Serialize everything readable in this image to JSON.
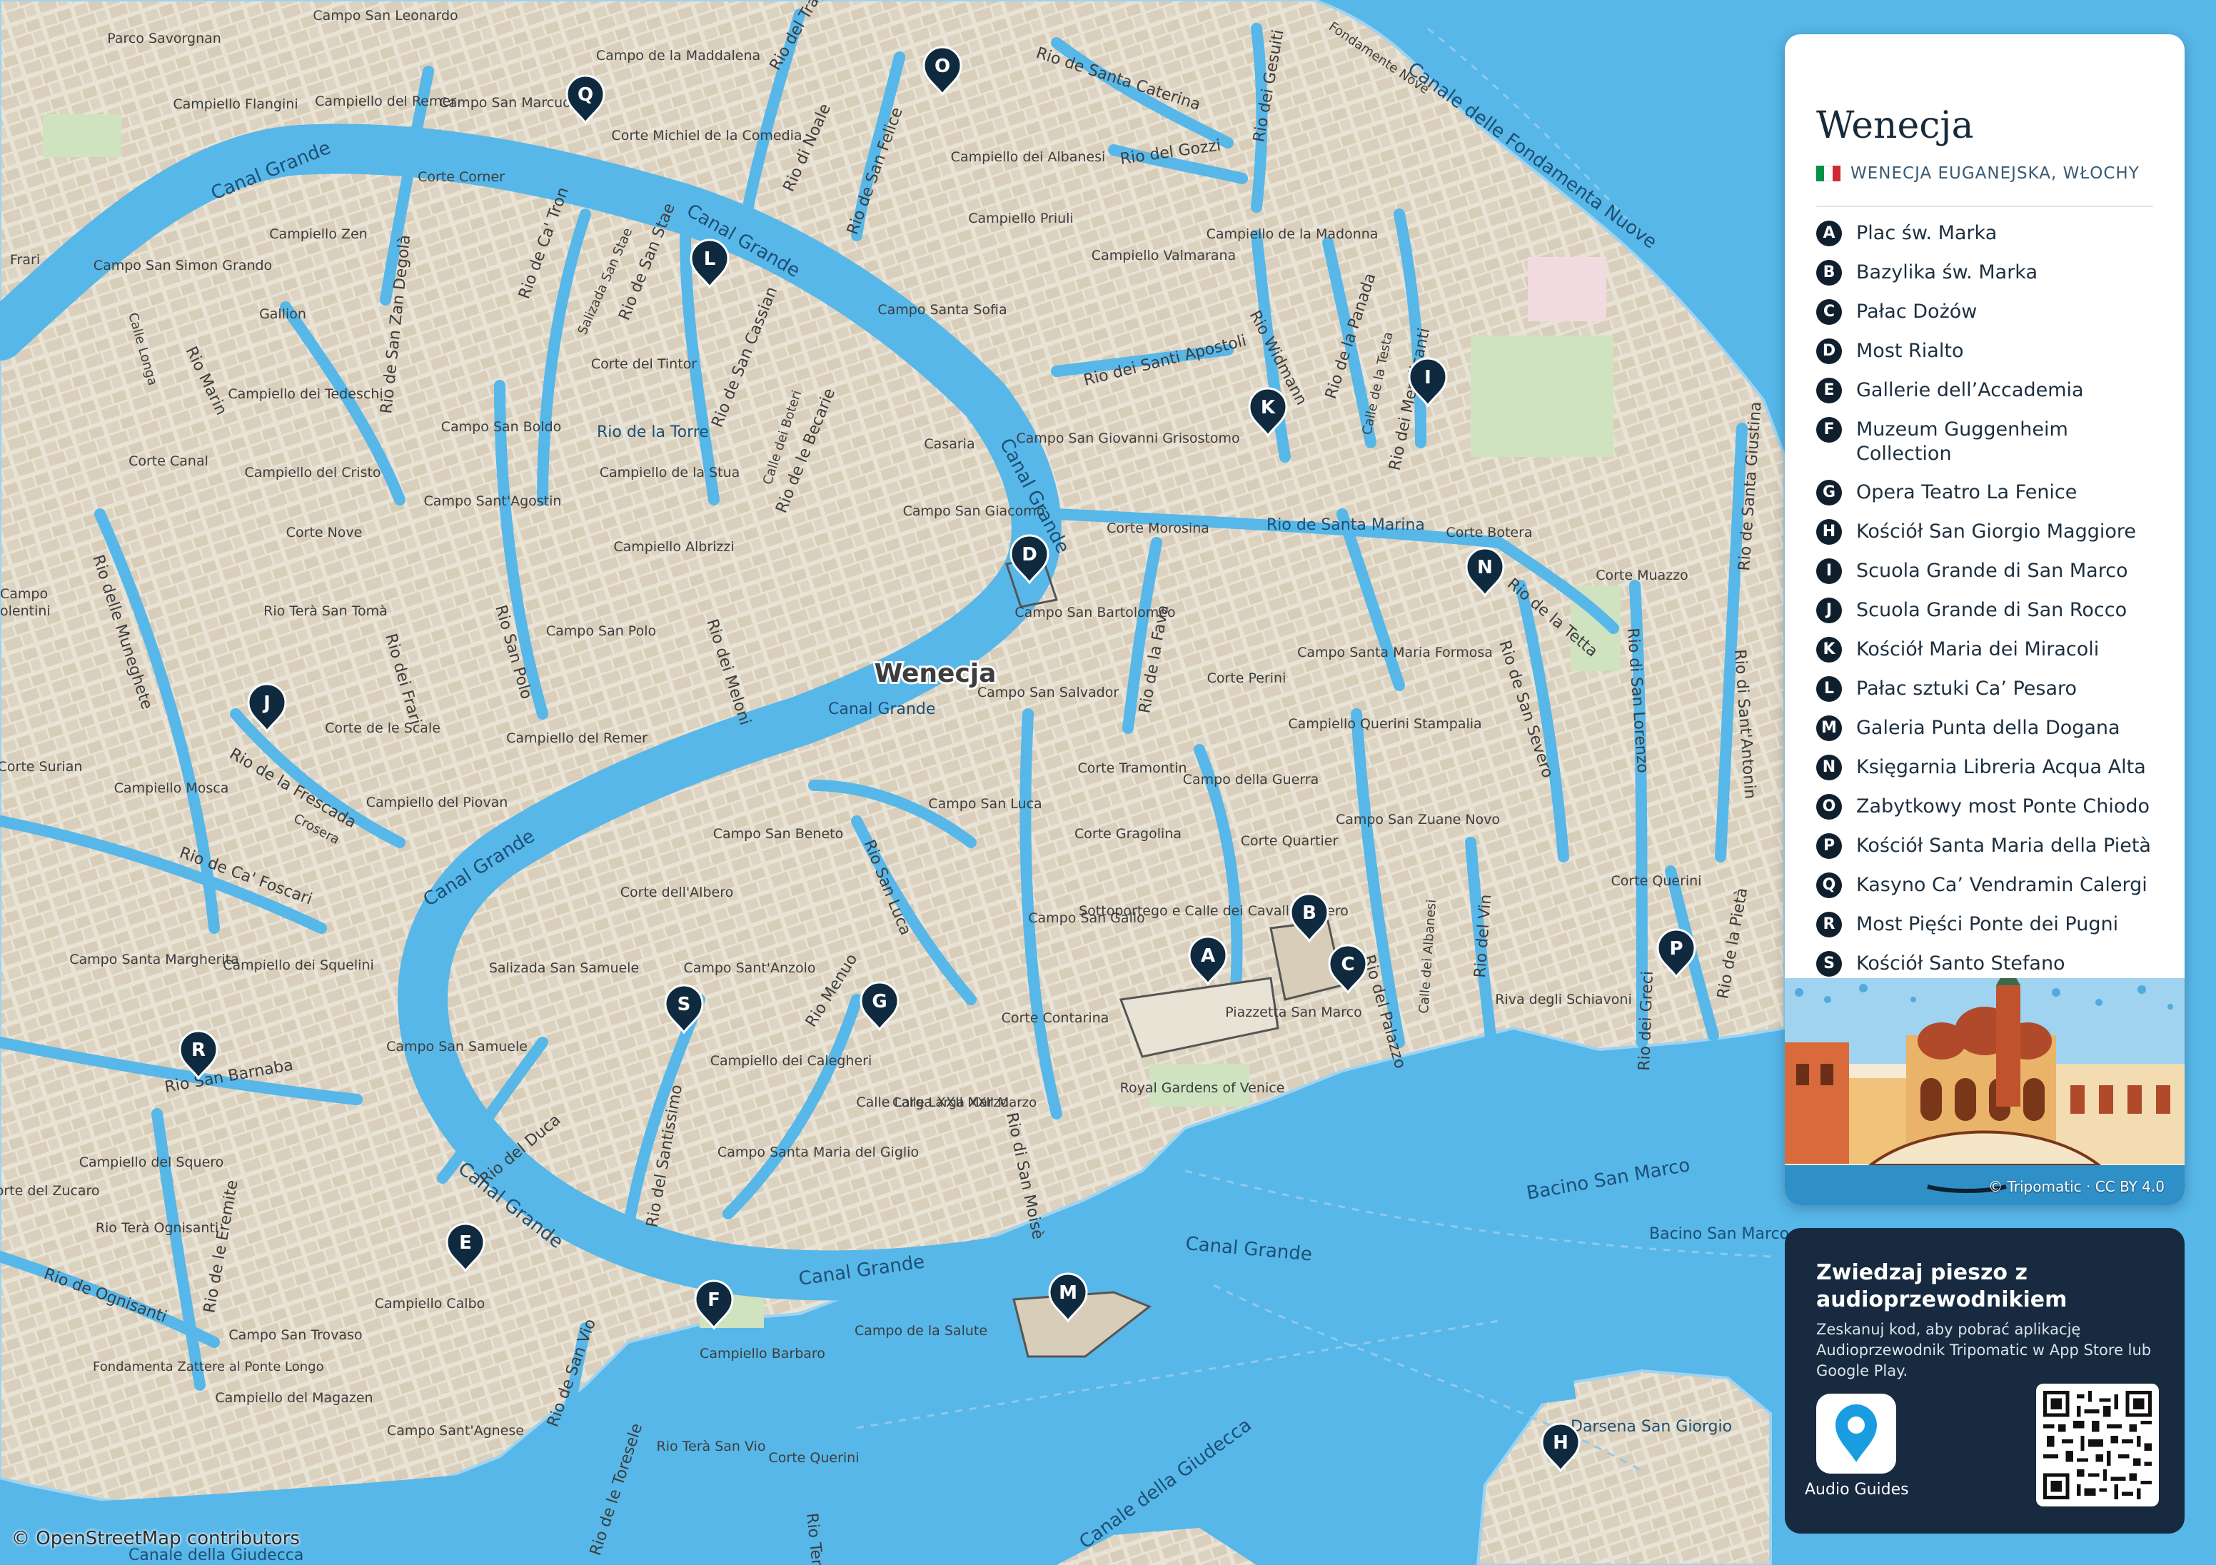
{
  "map": {
    "city_label": "Wenecja",
    "water_labels": [
      {
        "id": "canal-grande-1",
        "text": "Canal Grande"
      },
      {
        "id": "canal-grande-2",
        "text": "Canal Grande"
      },
      {
        "id": "canal-grande-3",
        "text": "Canal Grande"
      },
      {
        "id": "canal-grande-4",
        "text": "Canal Grande"
      },
      {
        "id": "canal-grande-5",
        "text": "Canal Grande"
      },
      {
        "id": "canal-grande-6",
        "text": "Canal Grande"
      },
      {
        "id": "canal-grande-7",
        "text": "Canal Grande"
      },
      {
        "id": "canal-grande-8",
        "text": "Canal Grande"
      },
      {
        "id": "bacino",
        "text": "Bacino San Marco"
      },
      {
        "id": "bacino-2",
        "text": "Bacino San Marco"
      },
      {
        "id": "darsena",
        "text": "Darsena San Giorgio"
      },
      {
        "id": "fondamenta-nuove",
        "text": "Canale delle Fondamenta Nuove"
      },
      {
        "id": "giudecca",
        "text": "Canale della Giudecca"
      },
      {
        "id": "giudecca-2",
        "text": "Canale della Giudecca"
      },
      {
        "id": "rio-torre",
        "text": "Rio de la Torre"
      },
      {
        "id": "rio-santa-marina",
        "text": "Rio de Santa Marina"
      }
    ],
    "street_labels": [
      {
        "id": "rio-trapolin",
        "text": "Rio del Trapolin"
      },
      {
        "id": "rio-santa-caterina",
        "text": "Rio de Santa Caterina"
      },
      {
        "id": "rio-noale",
        "text": "Rio di Noale"
      },
      {
        "id": "rio-san-felice",
        "text": "Rio de San Felice"
      },
      {
        "id": "rio-gozzi",
        "text": "Rio del Gozzi"
      },
      {
        "id": "rio-gesuiti",
        "text": "Rio dei Gesuiti"
      },
      {
        "id": "rio-ca-tron",
        "text": "Rio de Ca' Tron"
      },
      {
        "id": "rio-san-stae",
        "text": "Rio de San Stae"
      },
      {
        "id": "salizada-san-stae",
        "text": "Salizada San Stae"
      },
      {
        "id": "rio-san-cassian",
        "text": "Rio de San Cassian"
      },
      {
        "id": "rio-zan-degola",
        "text": "Rio de San Zan Degolà"
      },
      {
        "id": "rio-marin",
        "text": "Rio Marin"
      },
      {
        "id": "calle-longa",
        "text": "Calle Longa"
      },
      {
        "id": "calle-boteri",
        "text": "Calle dei Boteri"
      },
      {
        "id": "rio-becarie",
        "text": "Rio de le Becarie"
      },
      {
        "id": "rio-santi-apostoli",
        "text": "Rio dei Santi Apostoli"
      },
      {
        "id": "rio-widmann",
        "text": "Rio Widmann"
      },
      {
        "id": "rio-panada",
        "text": "Rio de la Panada"
      },
      {
        "id": "calle-testa",
        "text": "Calle de la Testa"
      },
      {
        "id": "rio-mendicanti",
        "text": "Rio dei Mendicanti"
      },
      {
        "id": "rio-santa-giustina",
        "text": "Rio de Santa Giustina"
      },
      {
        "id": "rio-muneghete",
        "text": "Rio delle Muneghete"
      },
      {
        "id": "rio-frari",
        "text": "Rio dei Frari"
      },
      {
        "id": "rio-san-polo",
        "text": "Rio San Polo"
      },
      {
        "id": "rio-meloni",
        "text": "Rio dei Meloni"
      },
      {
        "id": "rio-fava",
        "text": "Rio de la Fava"
      },
      {
        "id": "rio-tetta",
        "text": "Rio de la Tetta"
      },
      {
        "id": "rio-san-severo",
        "text": "Rio de San Severo"
      },
      {
        "id": "rio-san-lorenzo",
        "text": "Rio di San Lorenzo"
      },
      {
        "id": "rio-san-antonin",
        "text": "Rio di Sant'Antonin"
      },
      {
        "id": "rio-frescada",
        "text": "Rio de la Frescada"
      },
      {
        "id": "crosera",
        "text": "Crosera"
      },
      {
        "id": "rio-ca-foscari",
        "text": "Rio de Ca' Foscari"
      },
      {
        "id": "rio-san-luca",
        "text": "Rio San Luca"
      },
      {
        "id": "rio-menuo",
        "text": "Rio Menuo"
      },
      {
        "id": "rio-palazzo",
        "text": "Rio del Palazzo"
      },
      {
        "id": "calle-albanesi",
        "text": "Calle dei Albanesi"
      },
      {
        "id": "rio-vin",
        "text": "Rio del Vin"
      },
      {
        "id": "rio-greci",
        "text": "Rio dei Greci"
      },
      {
        "id": "rio-pieta",
        "text": "Rio de la Pietà"
      },
      {
        "id": "rio-san-barnaba",
        "text": "Rio San Barnaba"
      },
      {
        "id": "rio-duca",
        "text": "Rio del Duca"
      },
      {
        "id": "rio-santissimo",
        "text": "Rio del Santissimo"
      },
      {
        "id": "rio-san-moise",
        "text": "Rio di San Moisè"
      },
      {
        "id": "rio-eremite",
        "text": "Rio de le Eremite"
      },
      {
        "id": "rio-ognisanti",
        "text": "Rio de Ognisanti"
      },
      {
        "id": "rio-san-vio",
        "text": "Rio de San Vio"
      },
      {
        "id": "rio-toresele",
        "text": "Rio de le Toresele"
      },
      {
        "id": "rio-terra-san-vio",
        "text": "Rio Terà"
      },
      {
        "id": "fondamenta-nuove-st",
        "text": "Fondamente Nove"
      },
      {
        "id": "calle-larga-xxii",
        "text": "Calle Larga XXII Marzo"
      },
      {
        "id": "fondamenta-zattere",
        "text": "Fondamenta Zattere al Ponte Longo"
      }
    ],
    "place_labels": [
      {
        "id": "parco-savorgnan",
        "text": "Parco Savorgnan"
      },
      {
        "id": "campo-san-leonardo",
        "text": "Campo San Leonardo"
      },
      {
        "id": "campiello-flangini",
        "text": "Campiello Flangini"
      },
      {
        "id": "campiello-remer",
        "text": "Campiello del Remer"
      },
      {
        "id": "campo-maddalena",
        "text": "Campo de la Maddalena"
      },
      {
        "id": "campo-san-marcuola",
        "text": "Campo San Marcuola"
      },
      {
        "id": "corte-michiel",
        "text": "Corte Michiel de la Comedia"
      },
      {
        "id": "campiello-albanesi",
        "text": "Campiello dei Albanesi"
      },
      {
        "id": "corte-corner",
        "text": "Corte Corner"
      },
      {
        "id": "campiello-zen",
        "text": "Campiello Zen"
      },
      {
        "id": "campo-san-simon",
        "text": "Campo San Simon Grando"
      },
      {
        "id": "gallion",
        "text": "Gallion"
      },
      {
        "id": "campiello-priuli",
        "text": "Campiello Priuli"
      },
      {
        "id": "campiello-madonna",
        "text": "Campiello de la Madonna"
      },
      {
        "id": "campiello-valmarana",
        "text": "Campiello Valmarana"
      },
      {
        "id": "campo-santa-sofia",
        "text": "Campo Santa Sofia"
      },
      {
        "id": "corte-tintor",
        "text": "Corte del Tintor"
      },
      {
        "id": "campiello-tedeschi",
        "text": "Campiello dei Tedeschi"
      },
      {
        "id": "campo-san-boldo",
        "text": "Campo San Boldo"
      },
      {
        "id": "corte-canal",
        "text": "Corte Canal"
      },
      {
        "id": "campiello-cristo",
        "text": "Campiello del Cristo"
      },
      {
        "id": "campiello-stua",
        "text": "Campiello de la Stua"
      },
      {
        "id": "casaria",
        "text": "Casaria"
      },
      {
        "id": "campo-san-giovanni",
        "text": "Campo San Giovanni Grisostomo"
      },
      {
        "id": "campo-santagostin",
        "text": "Campo Sant'Agostin"
      },
      {
        "id": "corte-nove",
        "text": "Corte Nove"
      },
      {
        "id": "campiello-albrizzi",
        "text": "Campiello Albrizzi"
      },
      {
        "id": "campo-san-giacomo",
        "text": "Campo San Giacomo"
      },
      {
        "id": "corte-morosina",
        "text": "Corte Morosina"
      },
      {
        "id": "corte-botera",
        "text": "Corte Botera"
      },
      {
        "id": "corte-muazzo",
        "text": "Corte Muazzo"
      },
      {
        "id": "rio-terra-san-toma",
        "text": "Rio Terà San Tomà"
      },
      {
        "id": "campo-san-polo",
        "text": "Campo San Polo"
      },
      {
        "id": "campo-san-bartolomeo",
        "text": "Campo San Bartolomeo"
      },
      {
        "id": "campo-santa-maria-formosa",
        "text": "Campo Santa Maria Formosa"
      },
      {
        "id": "corte-perini",
        "text": "Corte Perini"
      },
      {
        "id": "corte-scale",
        "text": "Corte de le Scale"
      },
      {
        "id": "campiello-remer-2",
        "text": "Campiello del Remer"
      },
      {
        "id": "campo-san-salvador",
        "text": "Campo San Salvador"
      },
      {
        "id": "campiello-querini",
        "text": "Campiello Querini Stampalia"
      },
      {
        "id": "corte-surian",
        "text": "Corte Surian"
      },
      {
        "id": "campiello-mosca",
        "text": "Campiello Mosca"
      },
      {
        "id": "campiello-piovan",
        "text": "Campiello del Piovan"
      },
      {
        "id": "corte-tramontin",
        "text": "Corte Tramontin"
      },
      {
        "id": "campo-guerra",
        "text": "Campo della Guerra"
      },
      {
        "id": "campo-san-luca",
        "text": "Campo San Luca"
      },
      {
        "id": "campo-san-beneto",
        "text": "Campo San Beneto"
      },
      {
        "id": "corte-gragolina",
        "text": "Corte Gragolina"
      },
      {
        "id": "corte-quartier",
        "text": "Corte Quartier"
      },
      {
        "id": "campo-san-zuane",
        "text": "Campo San Zuane Novo"
      },
      {
        "id": "corte-albero",
        "text": "Corte dell'Albero"
      },
      {
        "id": "corte-querini",
        "text": "Corte Querini"
      },
      {
        "id": "sottoportego",
        "text": "Sottoportego e Calle dei Cavalletti Nero"
      },
      {
        "id": "campo-san-gallo",
        "text": "Campo San Gallo"
      },
      {
        "id": "campo-santa-margherita",
        "text": "Campo Santa Margherita"
      },
      {
        "id": "campiello-squelini",
        "text": "Campiello dei Squelini"
      },
      {
        "id": "salizada-san-samuele",
        "text": "Salizada San Samuele"
      },
      {
        "id": "campo-santanzolo",
        "text": "Campo Sant'Anzolo"
      },
      {
        "id": "piazzetta",
        "text": "Piazzetta San Marco"
      },
      {
        "id": "riva-schiavoni",
        "text": "Riva degli Schiavoni"
      },
      {
        "id": "corte-contarina",
        "text": "Corte Contarina"
      },
      {
        "id": "campo-san-samuele",
        "text": "Campo San Samuele"
      },
      {
        "id": "campiello-calegheri",
        "text": "Campiello dei Calegheri"
      },
      {
        "id": "royal-gardens",
        "text": "Royal Gardens of Venice"
      },
      {
        "id": "calle-larga-label",
        "text": "Calle Larga XXII Marzo"
      },
      {
        "id": "campiello-squero",
        "text": "Campiello del Squero"
      },
      {
        "id": "corte-zucaro",
        "text": "Corte del Zucaro"
      },
      {
        "id": "rio-terra-ognisanti",
        "text": "Rio Terà Ognisanti"
      },
      {
        "id": "campo-santa-maria-giglio",
        "text": "Campo Santa Maria del Giglio"
      },
      {
        "id": "campiello-calbo",
        "text": "Campiello Calbo"
      },
      {
        "id": "campo-san-trovaso",
        "text": "Campo San Trovaso"
      },
      {
        "id": "campiello-barbaro",
        "text": "Campiello Barbaro"
      },
      {
        "id": "campo-salute",
        "text": "Campo de la Salute"
      },
      {
        "id": "campiello-magazen",
        "text": "Campiello del Magazen"
      },
      {
        "id": "campo-santagnese",
        "text": "Campo Sant'Agnese"
      },
      {
        "id": "rio-terra-san-vio-2",
        "text": "Rio Terà San Vio"
      },
      {
        "id": "corte-querini-2",
        "text": "Corte Querini"
      },
      {
        "id": "frari-edge",
        "text": "Frari"
      },
      {
        "id": "valentini-edge",
        "text": "olentini"
      },
      {
        "id": "campo-left-edge",
        "text": "Campo"
      }
    ],
    "markers": [
      {
        "key": "A",
        "color": "#0f2a3f"
      },
      {
        "key": "B",
        "color": "#0f2a3f"
      },
      {
        "key": "C",
        "color": "#0f2a3f"
      },
      {
        "key": "D",
        "color": "#0f2a3f"
      },
      {
        "key": "E",
        "color": "#0f2a3f"
      },
      {
        "key": "F",
        "color": "#0f2a3f"
      },
      {
        "key": "G",
        "color": "#0f2a3f"
      },
      {
        "key": "H",
        "color": "#0f2a3f"
      },
      {
        "key": "I",
        "color": "#0f2a3f"
      },
      {
        "key": "J",
        "color": "#0f2a3f"
      },
      {
        "key": "K",
        "color": "#0f2a3f"
      },
      {
        "key": "L",
        "color": "#0f2a3f"
      },
      {
        "key": "M",
        "color": "#0f2a3f"
      },
      {
        "key": "N",
        "color": "#0f2a3f"
      },
      {
        "key": "O",
        "color": "#0f2a3f"
      },
      {
        "key": "P",
        "color": "#0f2a3f"
      },
      {
        "key": "Q",
        "color": "#0f2a3f"
      },
      {
        "key": "R",
        "color": "#0f2a3f"
      },
      {
        "key": "S",
        "color": "#0f2a3f"
      }
    ],
    "colors": {
      "water": "#57b7e9",
      "land": "#e9e3d6",
      "buildings": "#d8ceba",
      "park": "#cfe3c0",
      "marker": "#0f2a3f"
    },
    "osm_credit": "© OpenStreetMap contributors"
  },
  "panel": {
    "title": "Wenecja",
    "region": "WENECJA EUGANEJSKA, WŁOCHY",
    "flag_colors": [
      "#009246",
      "#ffffff",
      "#ce2b37"
    ],
    "legend": [
      {
        "key": "A",
        "label": "Plac św. Marka"
      },
      {
        "key": "B",
        "label": "Bazylika św. Marka"
      },
      {
        "key": "C",
        "label": "Pałac Dożów"
      },
      {
        "key": "D",
        "label": "Most Rialto"
      },
      {
        "key": "E",
        "label": "Gallerie dell’Accademia"
      },
      {
        "key": "F",
        "label": "Muzeum Guggenheim Collection"
      },
      {
        "key": "G",
        "label": "Opera Teatro La Fenice"
      },
      {
        "key": "H",
        "label": "Kościół San Giorgio Maggiore"
      },
      {
        "key": "I",
        "label": "Scuola Grande di San Marco"
      },
      {
        "key": "J",
        "label": "Scuola Grande di San Rocco"
      },
      {
        "key": "K",
        "label": "Kościół Maria dei Miracoli"
      },
      {
        "key": "L",
        "label": "Pałac sztuki Ca’ Pesaro"
      },
      {
        "key": "M",
        "label": "Galeria Punta della Dogana"
      },
      {
        "key": "N",
        "label": "Księgarnia Libreria Acqua Alta"
      },
      {
        "key": "O",
        "label": "Zabytkowy most Ponte Chiodo"
      },
      {
        "key": "P",
        "label": "Kościół Santa Maria della Pietà"
      },
      {
        "key": "Q",
        "label": "Kasyno Ca’ Vendramin Calergi"
      },
      {
        "key": "R",
        "label": "Most Pięści Ponte dei Pugni"
      },
      {
        "key": "S",
        "label": "Kościół Santo Stefano"
      }
    ],
    "art_credit": "© Tripomatic · CC BY 4.0"
  },
  "promo": {
    "title": "Zwiedzaj pieszo z audioprzewodnikiem",
    "text": "Zeskanuj kod, aby pobrać aplikację Audioprzewodnik Tripomatic w App Store lub Google Play.",
    "app_label": "Audio Guides",
    "app_icon": "location-pin-icon",
    "qr_icon": "qr-code-icon"
  }
}
